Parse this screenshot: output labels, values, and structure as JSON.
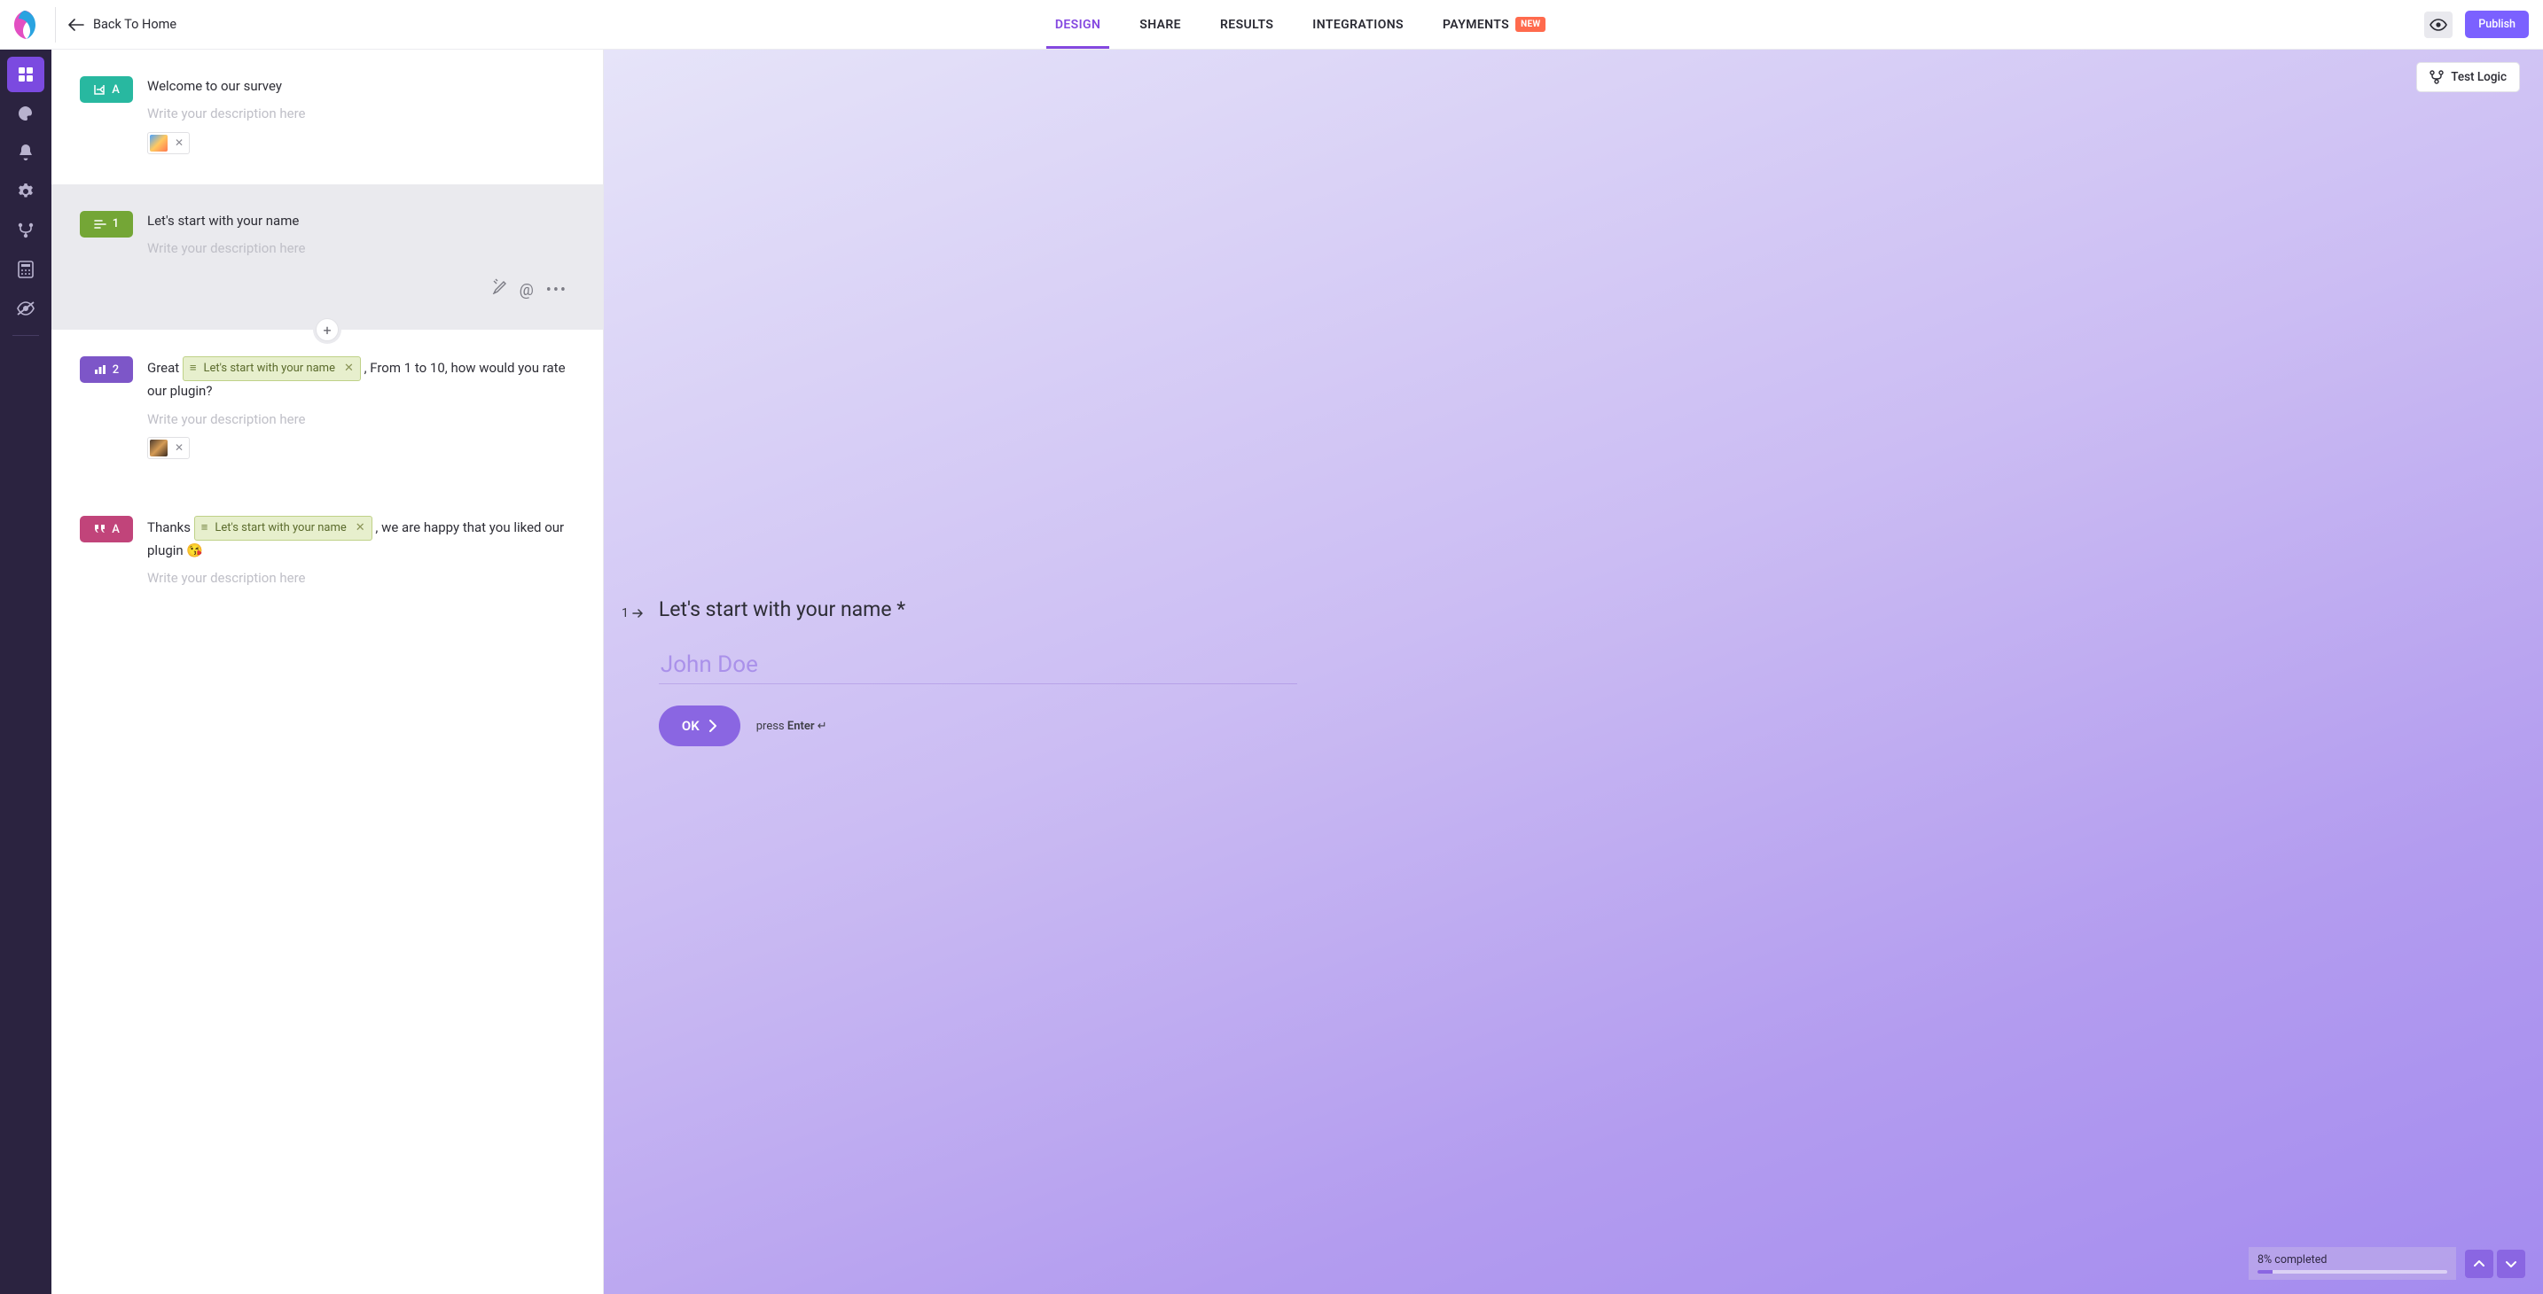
{
  "header": {
    "back_label": "Back To Home",
    "tabs": [
      {
        "label": "DESIGN",
        "active": true
      },
      {
        "label": "SHARE"
      },
      {
        "label": "RESULTS"
      },
      {
        "label": "INTEGRATIONS"
      },
      {
        "label": "PAYMENTS",
        "badge": "NEW"
      }
    ],
    "publish_label": "Publish"
  },
  "sidebar": {
    "items": [
      {
        "name": "blocks",
        "active": true
      },
      {
        "name": "theme"
      },
      {
        "name": "notifications"
      },
      {
        "name": "settings"
      },
      {
        "name": "logic"
      },
      {
        "name": "calculator"
      },
      {
        "name": "hidden"
      }
    ]
  },
  "blocks": [
    {
      "id": "welcome",
      "badge_letter": "A",
      "badge_color": "teal",
      "title": "Welcome to our survey",
      "desc_placeholder": "Write your description here",
      "has_attachment": true
    },
    {
      "id": "name",
      "badge_letter": "1",
      "badge_color": "green",
      "selected": true,
      "title": "Let's start with your name",
      "desc_placeholder": "Write your description here",
      "show_actions": true
    },
    {
      "id": "rating",
      "badge_letter": "2",
      "badge_color": "purple",
      "pre_text": "Great ",
      "recall_label": "Let's start with your name",
      "post_text": " , From 1 to 10, how would you rate our plugin?",
      "desc_placeholder": "Write your description here",
      "has_attachment": true
    },
    {
      "id": "thanks",
      "badge_letter": "A",
      "badge_color": "pink",
      "pre_text": "Thanks ",
      "recall_label": "Let's start with your name",
      "post_text": " , we are happy that you liked our plugin 😘",
      "desc_placeholder": "Write your description here"
    }
  ],
  "preview": {
    "test_logic_label": "Test Logic",
    "q_index": "1",
    "q_title": "Let's start with your name",
    "q_required_mark": "*",
    "answer_placeholder": "John Doe",
    "ok_label": "OK",
    "press_label_pre": "press ",
    "press_label_key": "Enter",
    "enter_glyph": "↵",
    "progress_label": "8% completed",
    "progress_percent": 8
  }
}
